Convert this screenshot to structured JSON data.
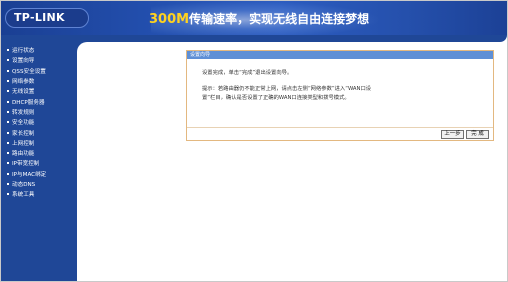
{
  "header": {
    "logo": "TP-LINK",
    "slogan_accent": "300M",
    "slogan_rest": "传输速率，实现无线自由连接梦想"
  },
  "sidebar": {
    "items": [
      {
        "label": "运行状态"
      },
      {
        "label": "设置向导"
      },
      {
        "label": "QSS安全设置"
      },
      {
        "label": "网络参数"
      },
      {
        "label": "无线设置"
      },
      {
        "label": "DHCP服务器"
      },
      {
        "label": "转发规则"
      },
      {
        "label": "安全功能"
      },
      {
        "label": "家长控制"
      },
      {
        "label": "上网控制"
      },
      {
        "label": "路由功能"
      },
      {
        "label": "IP带宽控制"
      },
      {
        "label": "IP与MAC绑定"
      },
      {
        "label": "动态DNS"
      },
      {
        "label": "系统工具"
      }
    ]
  },
  "wizard": {
    "title": "设置向导",
    "message_line1": "设置完成，单击“完成”退出设置向导。",
    "message_line2": "提示：若路由器仍不能正常上网，请点击左侧“网络参数”进入“WAN口设",
    "message_line3": "置”栏目，确认是否设置了正确的WAN口连接类型和拨号模式。",
    "back_label": "上一步",
    "finish_label": "完 成"
  },
  "colors": {
    "nav_blue": "#1f4797",
    "panel_header": "#5e8fd6",
    "panel_border": "#e3b880",
    "slogan_accent": "#ffd21e"
  }
}
